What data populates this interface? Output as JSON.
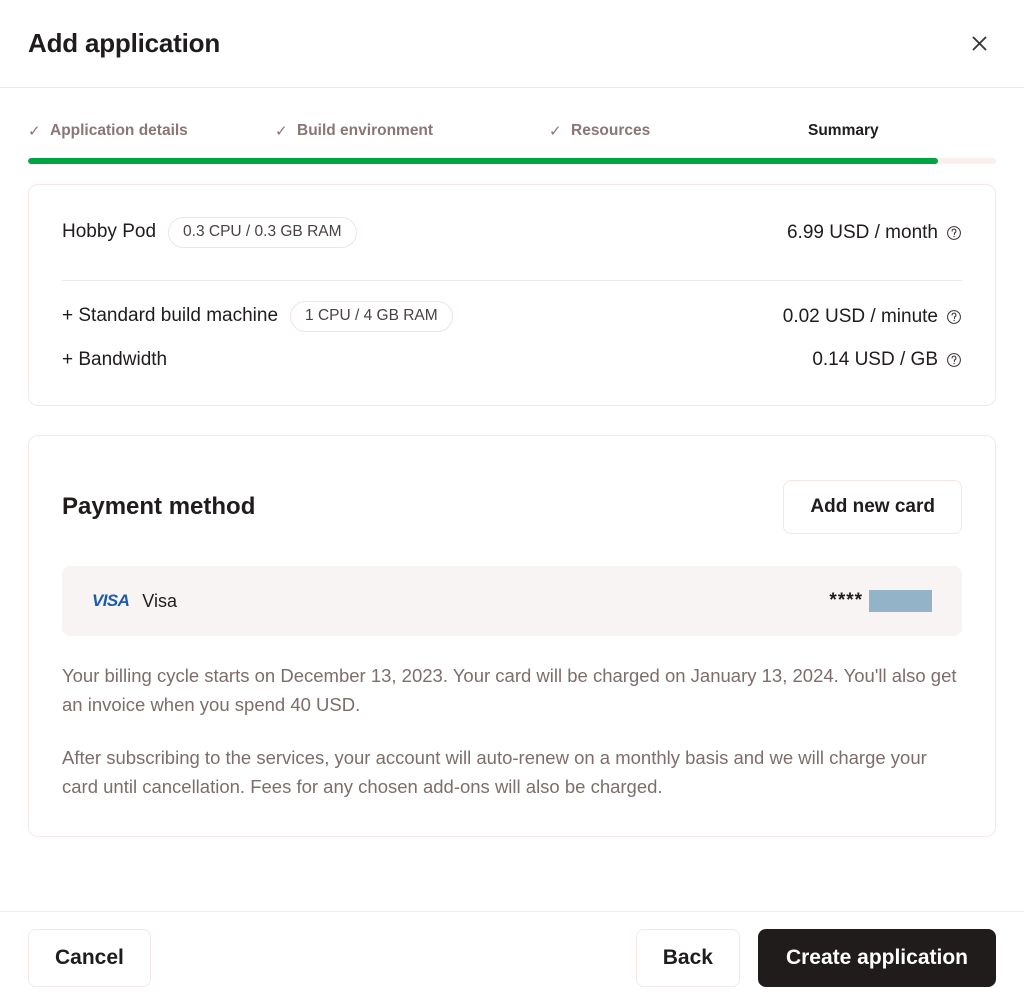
{
  "header": {
    "title": "Add application",
    "close_icon": "close-icon"
  },
  "stepper": {
    "progress_percent": 94,
    "progress_color": "#00a441",
    "check_glyph": "✓",
    "steps": [
      {
        "label": "Application details",
        "state": "completed"
      },
      {
        "label": "Build environment",
        "state": "completed"
      },
      {
        "label": "Resources",
        "state": "completed"
      },
      {
        "label": "Summary",
        "state": "active"
      }
    ]
  },
  "summary": {
    "plan": {
      "name": "Hobby Pod",
      "spec_chip": "0.3 CPU / 0.3 GB RAM",
      "price": "6.99 USD / month",
      "help_icon": "help-circle-icon"
    },
    "addons": [
      {
        "name": "+ Standard build machine",
        "spec_chip": "1 CPU / 4 GB RAM",
        "price": "0.02 USD / minute",
        "help_icon": "help-circle-icon"
      },
      {
        "name": "+ Bandwidth",
        "spec_chip": "",
        "price": "0.14 USD / GB",
        "help_icon": "help-circle-icon"
      }
    ]
  },
  "payment": {
    "title": "Payment method",
    "add_card_label": "Add new card",
    "saved_card": {
      "logo_text": "VISA",
      "brand": "Visa",
      "mask": "****",
      "number_redacted": true,
      "redaction_color": "#93b4c8"
    },
    "notes": [
      "Your billing cycle starts on December 13, 2023. Your card will be charged on January 13, 2024. You'll also get an invoice when you spend 40 USD.",
      "After subscribing to the services, your account will auto-renew on a monthly basis and we will charge your card until cancellation. Fees for any chosen add-ons will also be charged."
    ]
  },
  "footer": {
    "cancel_label": "Cancel",
    "back_label": "Back",
    "submit_label": "Create application"
  }
}
